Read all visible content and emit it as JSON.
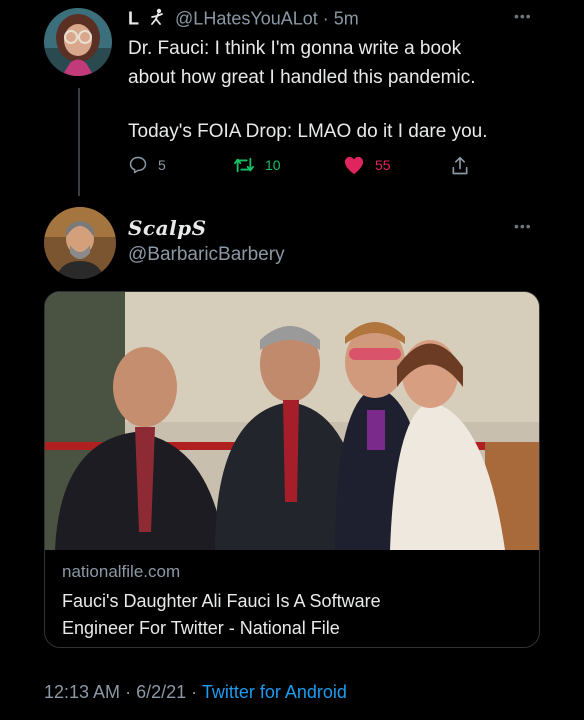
{
  "tweet1": {
    "name": "L",
    "handle": "@LHatesYouALot",
    "separator": "·",
    "time": "5m",
    "line1": "Dr. Fauci: I think I'm gonna write a book",
    "line2": "about how great I handled this pandemic.",
    "line3": "Today's FOIA Drop: LMAO do it I dare you.",
    "reply_count": "5",
    "retweet_count": "10",
    "like_count": "55"
  },
  "tweet2": {
    "name": "ScalpS",
    "handle": "@BarbaricBarbery",
    "card": {
      "domain": "nationalfile.com",
      "title_line1": "Fauci's Daughter Ali Fauci Is A Software",
      "title_line2": "Engineer For Twitter - National File"
    },
    "footer": {
      "time": "12:13 AM",
      "sep1": "·",
      "date": "6/2/21",
      "sep2": "·",
      "source": "Twitter for Android"
    }
  },
  "colors": {
    "background": "#000000",
    "text": "#e7e9ea",
    "muted": "#8b98a5",
    "retweet": "#17bf63",
    "like": "#e0245e",
    "link": "#1d9bf0"
  },
  "icons": [
    "reply-icon",
    "retweet-icon",
    "heart-icon",
    "share-icon",
    "more-icon",
    "stick-figure-icon"
  ]
}
